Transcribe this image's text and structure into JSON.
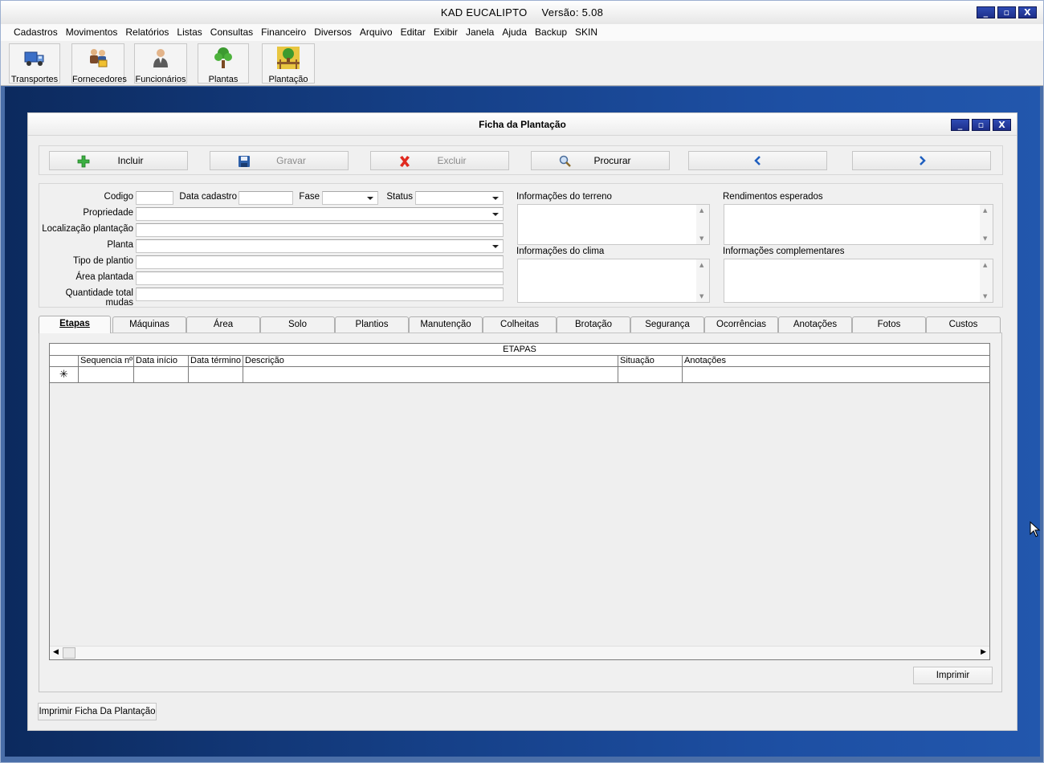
{
  "app": {
    "title_name": "KAD EUCALIPTO",
    "title_version": "Versão: 5.08",
    "window_buttons": [
      "_",
      "▫",
      "X"
    ]
  },
  "menu": [
    "Cadastros",
    "Movimentos",
    "Relatórios",
    "Listas",
    "Consultas",
    "Financeiro",
    "Diversos",
    "Arquivo",
    "Editar",
    "Exibir",
    "Janela",
    "Ajuda",
    "Backup",
    "SKIN"
  ],
  "toolbar": [
    {
      "label": "Transportes",
      "icon": "truck-icon"
    },
    {
      "label": "Fornecedores",
      "icon": "suppliers-icon"
    },
    {
      "label": "Funcionários",
      "icon": "employee-icon"
    },
    {
      "label": "Plantas",
      "icon": "tree-icon"
    },
    {
      "label": "Plantação",
      "icon": "plantation-icon"
    }
  ],
  "form": {
    "title": "Ficha da Plantação",
    "actions": {
      "incluir": "Incluir",
      "gravar": "Gravar",
      "excluir": "Excluir",
      "procurar": "Procurar"
    },
    "labels": {
      "codigo": "Codigo",
      "data_cadastro": "Data cadastro",
      "fase": "Fase",
      "status": "Status",
      "propriedade": "Propriedade",
      "localizacao": "Localização plantação",
      "planta": "Planta",
      "tipo_plantio": "Tipo de plantio",
      "area_plantada": "Área plantada",
      "quantidade_mudas": "Quantidade total mudas",
      "info_terreno": "Informações do terreno",
      "rendimentos": "Rendimentos esperados",
      "info_clima": "Informações do clima",
      "info_complementares": "Informações complementares"
    },
    "values": {
      "codigo": "",
      "data_cadastro": "",
      "fase": "",
      "status": "",
      "propriedade": "",
      "localizacao": "",
      "planta": "",
      "tipo_plantio": "",
      "area_plantada": "",
      "quantidade_mudas": ""
    }
  },
  "tabs": [
    "Etapas",
    "Máquinas",
    "Área",
    "Solo",
    "Plantios",
    "Manutenção",
    "Colheitas",
    "Brotação",
    "Segurança",
    "Ocorrências",
    "Anotações",
    "Fotos",
    "Custos"
  ],
  "active_tab": "Etapas",
  "grid": {
    "caption": "ETAPAS",
    "columns": [
      "Sequencia nº",
      "Data início",
      "Data término",
      "Descrição",
      "Situação",
      "Anotações"
    ],
    "new_row_marker": "✳",
    "rows": []
  },
  "buttons": {
    "imprimir": "Imprimir",
    "imprimir_ficha": "Imprimir Ficha Da Plantação"
  }
}
